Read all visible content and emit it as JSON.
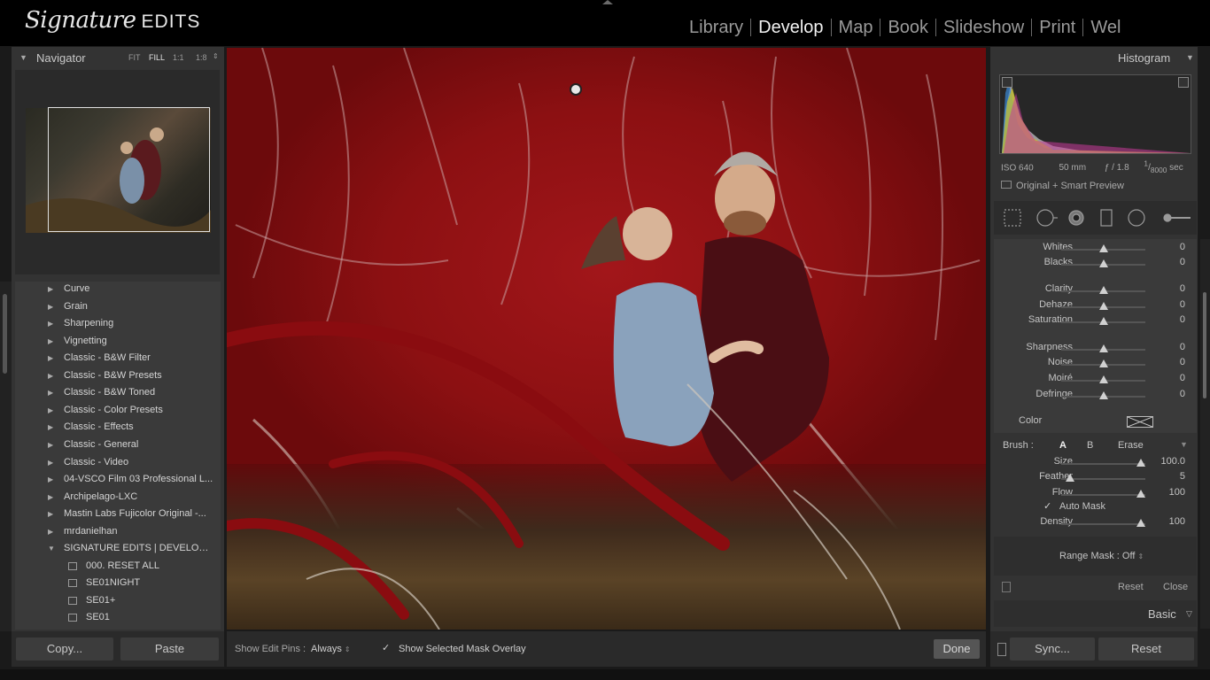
{
  "logo": {
    "script": "Signature",
    "caps": "EDITS"
  },
  "modules": [
    "Library",
    "Develop",
    "Map",
    "Book",
    "Slideshow",
    "Print",
    "Wel"
  ],
  "active_module": "Develop",
  "navigator": {
    "title": "Navigator",
    "zoom_fit": "FIT",
    "zoom_fill": "FILL",
    "zoom_11": "1:1",
    "zoom_18": "1:8"
  },
  "presets": [
    {
      "label": "Curve",
      "level": "folder"
    },
    {
      "label": "Grain",
      "level": "folder"
    },
    {
      "label": "Sharpening",
      "level": "folder"
    },
    {
      "label": "Vignetting",
      "level": "folder"
    },
    {
      "label": "Classic - B&W Filter",
      "level": "folder"
    },
    {
      "label": "Classic - B&W Presets",
      "level": "folder"
    },
    {
      "label": "Classic - B&W Toned",
      "level": "folder"
    },
    {
      "label": "Classic - Color Presets",
      "level": "folder"
    },
    {
      "label": "Classic - Effects",
      "level": "folder"
    },
    {
      "label": "Classic - General",
      "level": "folder"
    },
    {
      "label": "Classic - Video",
      "level": "folder"
    },
    {
      "label": "04-VSCO Film 03 Professional L...",
      "level": "folder"
    },
    {
      "label": "Archipelago-LXC",
      "level": "folder"
    },
    {
      "label": "Mastin Labs Fujicolor Original -...",
      "level": "folder"
    },
    {
      "label": "mrdanielhan",
      "level": "folder"
    },
    {
      "label": "SIGNATURE EDITS | DEVELOP PR...",
      "level": "open"
    },
    {
      "label": "000. RESET ALL",
      "level": "child"
    },
    {
      "label": "SE01NIGHT",
      "level": "child"
    },
    {
      "label": "SE01+",
      "level": "child"
    },
    {
      "label": "SE01",
      "level": "child"
    }
  ],
  "left_buttons": {
    "copy": "Copy...",
    "paste": "Paste"
  },
  "toolbar": {
    "pins_label": "Show Edit Pins :",
    "pins_value": "Always",
    "mask_overlay": "Show Selected Mask Overlay",
    "done": "Done"
  },
  "histogram": {
    "title": "Histogram",
    "iso": "ISO 640",
    "focal": "50 mm",
    "aperture": "ƒ / 1.8",
    "shutter_num": "1",
    "shutter_den": "8000",
    "shutter_unit": "sec",
    "preview": "Original + Smart Preview"
  },
  "sliders": [
    {
      "name": "Whites",
      "value": "0",
      "pos": 0.5
    },
    {
      "name": "Blacks",
      "value": "0",
      "pos": 0.5
    },
    {
      "name": "Clarity",
      "value": "0",
      "pos": 0.5
    },
    {
      "name": "Dehaze",
      "value": "0",
      "pos": 0.5
    },
    {
      "name": "Saturation",
      "value": "0",
      "pos": 0.5
    },
    {
      "name": "Sharpness",
      "value": "0",
      "pos": 0.5
    },
    {
      "name": "Noise",
      "value": "0",
      "pos": 0.5
    },
    {
      "name": "Moiré",
      "value": "0",
      "pos": 0.5
    },
    {
      "name": "Defringe",
      "value": "0",
      "pos": 0.5
    }
  ],
  "color_label": "Color",
  "brush": {
    "label": "Brush :",
    "a": "A",
    "b": "B",
    "erase": "Erase"
  },
  "brush_sliders": [
    {
      "name": "Size",
      "value": "100.0",
      "pos": 0.95
    },
    {
      "name": "Feather",
      "value": "5",
      "pos": 0.1
    },
    {
      "name": "Flow",
      "value": "100",
      "pos": 0.95
    }
  ],
  "auto_mask": "Auto Mask",
  "density": {
    "name": "Density",
    "value": "100",
    "pos": 0.95
  },
  "range_mask": "Range Mask : Off",
  "panel_reset": "Reset",
  "panel_close": "Close",
  "basic_label": "Basic",
  "right_buttons": {
    "sync": "Sync...",
    "reset": "Reset"
  }
}
